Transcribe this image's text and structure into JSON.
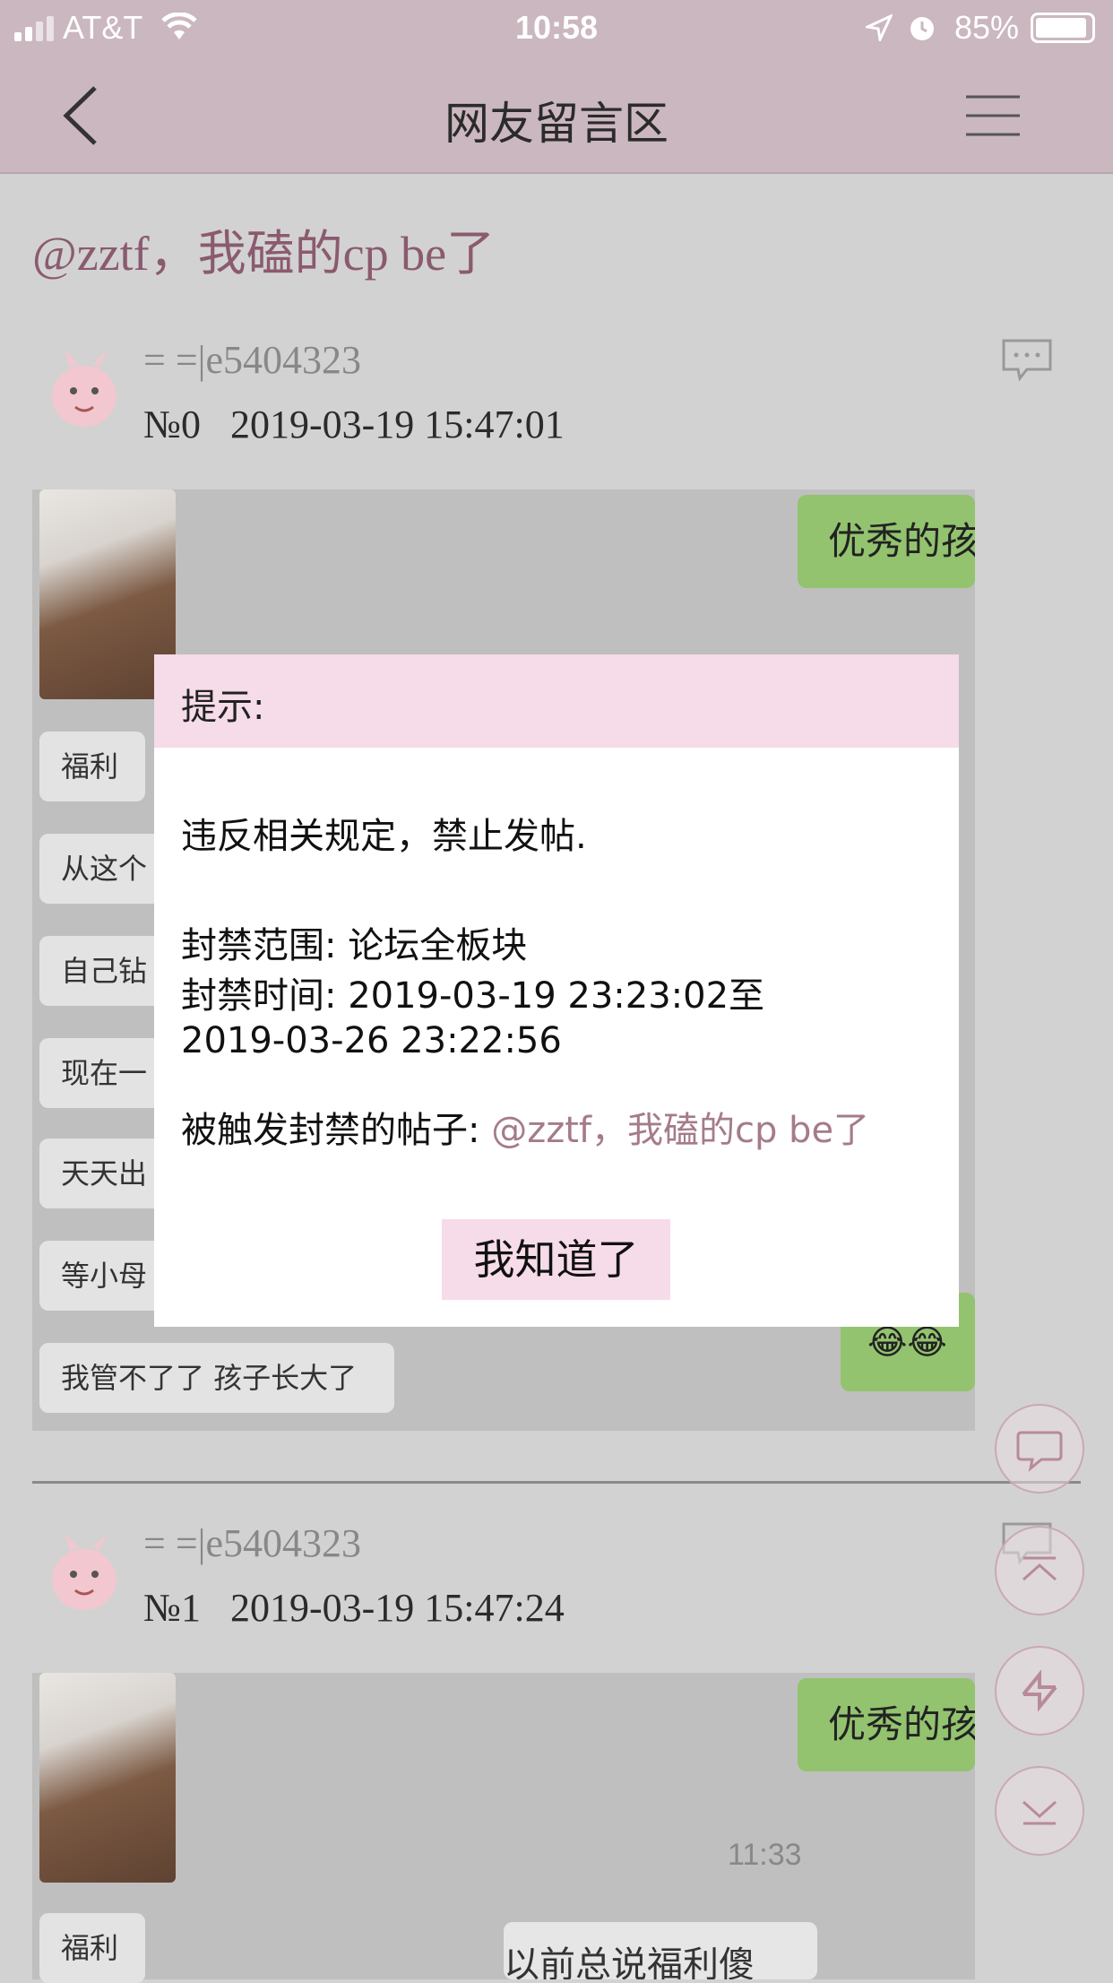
{
  "status_bar": {
    "carrier": "AT&T",
    "time": "10:58",
    "battery": "85%"
  },
  "nav": {
    "title": "网友留言区"
  },
  "thread": {
    "title": "@zztf，我磕的cp be了"
  },
  "posts": [
    {
      "username": "= =|e5404323",
      "number": "№0",
      "datetime": "2019-03-19 15:47:01",
      "bubble": "优秀的孩",
      "chips": [
        "福利",
        "从这个",
        "自己钻",
        "现在一",
        "天天出",
        "等小母",
        "我管不了了 孩子长大了"
      ],
      "emoji": "😂😂"
    },
    {
      "username": "= =|e5404323",
      "number": "№1",
      "datetime": "2019-03-19 15:47:24",
      "bubble": "优秀的孩",
      "time_label": "11:33",
      "chips": [
        "福利"
      ],
      "partial_text": "以前总说福利傻"
    }
  ],
  "modal": {
    "header": "提示:",
    "message": "违反相关规定，禁止发帖.",
    "scope_label": "封禁范围: ",
    "scope_value": "论坛全板块",
    "time_label": "封禁时间: ",
    "time_value_line1": "2019-03-19 23:23:02至",
    "time_value_line2": "2019-03-26 23:22:56",
    "trigger_label": "被触发封禁的帖子: ",
    "trigger_value": "@zztf，我磕的cp be了",
    "ack_button": "我知道了"
  },
  "colors": {
    "nav_bg": "#cbb7bf",
    "accent_title": "#8b5a6e",
    "modal_header": "#f6dbe8",
    "link": "#a57b8b",
    "bubble": "#93c36f"
  },
  "icons": [
    "back-chevron-icon",
    "menu-icon",
    "comment-icon",
    "chat-icon",
    "scroll-top-icon",
    "refresh-icon",
    "scroll-bottom-icon"
  ]
}
